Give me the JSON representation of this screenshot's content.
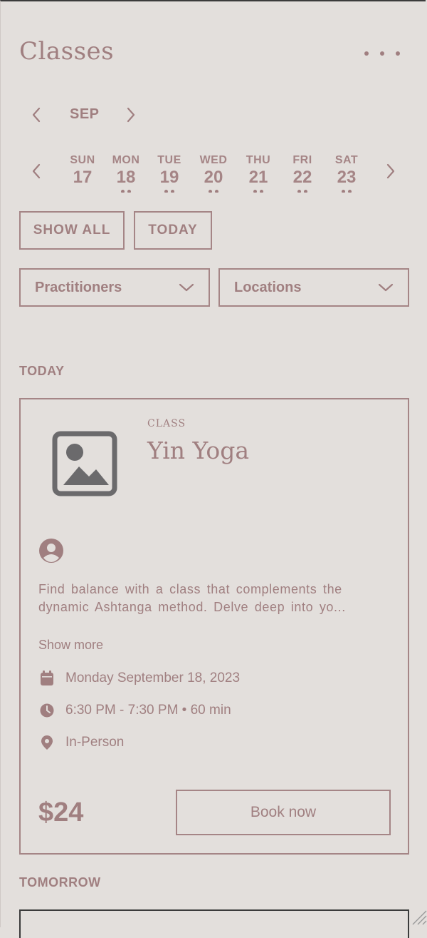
{
  "header": {
    "title": "Classes",
    "menu_icon": "more-horizontal-icon"
  },
  "month_nav": {
    "month": "SEP",
    "prev_icon": "chevron-left-icon",
    "next_icon": "chevron-right-icon"
  },
  "week": {
    "days": [
      {
        "name": "SUN",
        "date": "17"
      },
      {
        "name": "MON",
        "date": "18"
      },
      {
        "name": "TUE",
        "date": "19"
      },
      {
        "name": "WED",
        "date": "20"
      },
      {
        "name": "THU",
        "date": "21"
      },
      {
        "name": "FRI",
        "date": "22"
      },
      {
        "name": "SAT",
        "date": "23"
      }
    ]
  },
  "filters": {
    "show_all": "SHOW ALL",
    "today": "TODAY",
    "practitioners": "Practitioners",
    "locations": "Locations"
  },
  "sections": {
    "today": "TODAY",
    "tomorrow": "TOMORROW"
  },
  "class_card": {
    "type_label": "CLASS",
    "name": "Yin Yoga",
    "description_line1": "Find balance with a class that complements the",
    "description_line2": "dynamic Ashtanga method. Delve deep into yo...",
    "show_more": "Show more",
    "date": "Monday September 18, 2023",
    "time": "6:30 PM - 7:30 PM • 60 min",
    "location": "In-Person",
    "price": "$24",
    "book_label": "Book now"
  },
  "colors": {
    "accent": "#a07f80",
    "background": "#e3dfdc",
    "image_icon": "#6b6a6c"
  }
}
